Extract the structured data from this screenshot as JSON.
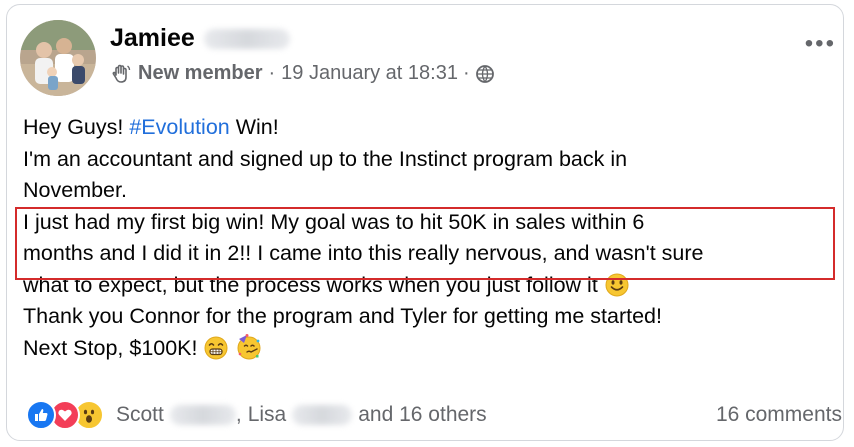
{
  "post": {
    "author_first_name": "Jamiee",
    "badge_icon": "waving-hand-icon",
    "badge_label": "New member",
    "timestamp": "19 January at 18:31",
    "separator": "·",
    "audience_icon": "globe-icon",
    "more_label": "•••"
  },
  "content": {
    "line1_before": "Hey Guys! ",
    "hashtag": "#Evolution",
    "line1_after": " Win!",
    "line2": "I'm an accountant and signed up to the Instinct program back in",
    "line3": "November.",
    "line4": "I just had my first big win! My goal was to hit 50K in sales within 6",
    "line5": "months and I did it in 2!!  I came into this really nervous, and wasn't sure",
    "line6": "what to expect, but the process works when you just follow it",
    "line7": "Thank you Connor for the program and Tyler for getting me started!",
    "line8": "Next Stop, $100K!"
  },
  "footer": {
    "reaction_icons": [
      "like-icon",
      "love-icon",
      "wow-icon"
    ],
    "name1_first": "Scott",
    "separator": ",",
    "name2_first": "Lisa",
    "others": "and 16 others",
    "comments": "16 comments"
  },
  "colors": {
    "highlight_border": "#d42b2b",
    "hashtag": "#216fdb",
    "secondary_text": "#65676b"
  }
}
